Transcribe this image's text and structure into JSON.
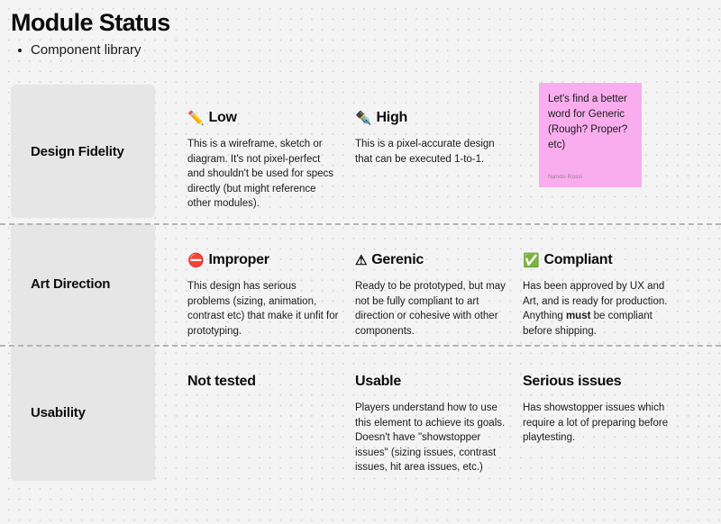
{
  "header": {
    "title": "Module Status",
    "bullets": [
      {
        "label": "Component library"
      }
    ]
  },
  "colors": {
    "background": "#f4f4f4",
    "dot_grid": "#d4d4d4",
    "row_label_card": "#e6e6e6",
    "separator": "#b4b4b4",
    "sticky_note": "#F9ADEE",
    "text": "#1a1a1a"
  },
  "matrix": {
    "rows": [
      {
        "label": "Design Fidelity",
        "cells": [
          {
            "icon": "✏️",
            "icon_name": "pencil-icon",
            "heading": "Low",
            "body": "This is a wireframe, sketch or diagram. It's not pixel-perfect and shouldn't be used for specs directly (but might reference other modules)."
          },
          {
            "icon": "✒️",
            "icon_name": "fountain-pen-icon",
            "heading": "High",
            "body": "This is a pixel-accurate design that can be executed 1-to-1."
          },
          {
            "icon": "",
            "icon_name": "",
            "heading": "",
            "body": ""
          }
        ]
      },
      {
        "label": "Art Direction",
        "cells": [
          {
            "icon": "⛔",
            "icon_name": "no-entry-icon",
            "heading": "Improper",
            "body": "This design has serious problems (sizing, animation, contrast etc) that make it unfit for prototyping."
          },
          {
            "icon": "⚠",
            "icon_name": "warning-triangle-icon",
            "heading": "Gerenic",
            "body": "Ready to be prototyped, but may not be fully compliant to art direction or cohesive with other components."
          },
          {
            "icon": "✅",
            "icon_name": "green-check-box-icon",
            "heading": "Compliant",
            "body_pre": "Has been approved by UX and Art, and is ready for production. Anything ",
            "body_bold": "must",
            "body_post": " be compliant before shipping."
          }
        ]
      },
      {
        "label": "Usability",
        "cells": [
          {
            "icon": "",
            "icon_name": "",
            "heading": "Not tested",
            "body": ""
          },
          {
            "icon": "",
            "icon_name": "",
            "heading": "Usable",
            "body_line1": "Players understand how to use this element to achieve its goals.",
            "body_line2": "Doesn't have \"showstopper issues\" (sizing issues, contrast issues, hit area issues, etc.)"
          },
          {
            "icon": "",
            "icon_name": "",
            "heading": "Serious issues",
            "body": "Has showstopper issues which require a lot of preparing before playtesting."
          }
        ]
      }
    ]
  },
  "sticky_note": {
    "text": "Let's find a better word for Generic (Rough? Proper? etc)",
    "author": "Nando Rossi"
  }
}
